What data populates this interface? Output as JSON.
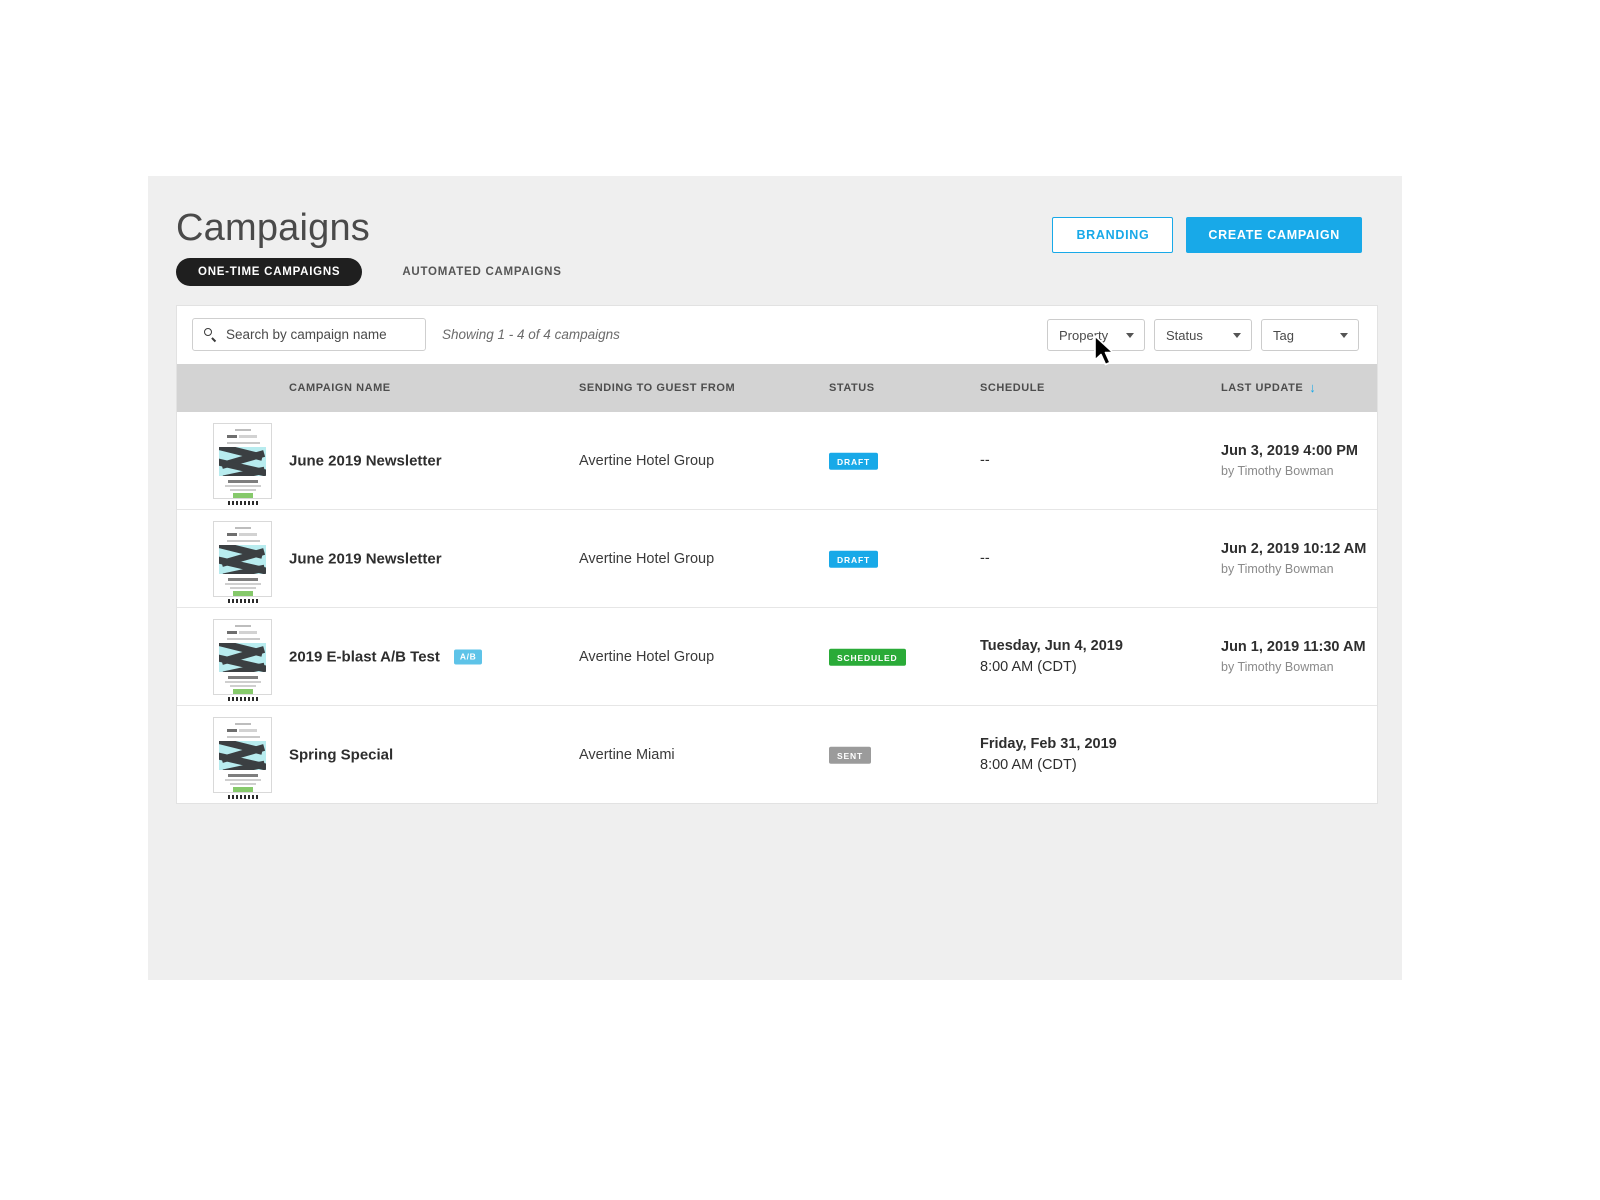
{
  "header": {
    "title": "Campaigns",
    "branding_label": "BRANDING",
    "create_label": "CREATE CAMPAIGN"
  },
  "tabs": [
    {
      "label": "ONE-TIME CAMPAIGNS",
      "active": true
    },
    {
      "label": "AUTOMATED CAMPAIGNS",
      "active": false
    }
  ],
  "toolbar": {
    "search_placeholder": "Search by campaign name",
    "search_value": "",
    "showing_text": "Showing 1 - 4 of 4 campaigns",
    "filters": [
      {
        "label": "Property"
      },
      {
        "label": "Status"
      },
      {
        "label": "Tag"
      }
    ]
  },
  "table": {
    "columns": {
      "name": "CAMPAIGN NAME",
      "sending": "SENDING TO GUEST FROM",
      "status": "STATUS",
      "schedule": "SCHEDULE",
      "last_update": "LAST UPDATE",
      "sort_arrow": "↓"
    },
    "rows": [
      {
        "name": "June 2019 Newsletter",
        "ab": "",
        "sending": "Avertine Hotel Group",
        "status": "DRAFT",
        "status_kind": "draft",
        "schedule_date": "--",
        "schedule_time": "",
        "update_date": "Jun 3, 2019 4:00 PM",
        "update_by": "by Timothy Bowman"
      },
      {
        "name": "June 2019 Newsletter",
        "ab": "",
        "sending": "Avertine Hotel Group",
        "status": "DRAFT",
        "status_kind": "draft",
        "schedule_date": "--",
        "schedule_time": "",
        "update_date": "Jun 2, 2019 10:12 AM",
        "update_by": "by Timothy Bowman"
      },
      {
        "name": "2019 E-blast  A/B Test",
        "ab": "A/B",
        "sending": "Avertine Hotel Group",
        "status": "SCHEDULED",
        "status_kind": "scheduled",
        "schedule_date": "Tuesday, Jun 4, 2019",
        "schedule_time": "8:00 AM (CDT)",
        "update_date": "Jun 1, 2019 11:30 AM",
        "update_by": "by Timothy Bowman"
      },
      {
        "name": "Spring Special",
        "ab": "",
        "sending": "Avertine Miami",
        "status": "SENT",
        "status_kind": "sent",
        "schedule_date": "Friday, Feb 31, 2019",
        "schedule_time": "8:00 AM (CDT)",
        "update_date": "",
        "update_by": ""
      }
    ]
  },
  "colors": {
    "accent": "#18a9e8",
    "scheduled": "#2aab38",
    "sent": "#9b9b9b",
    "ab_badge": "#5ec3e8",
    "canvas": "#efefef",
    "table_head": "#d3d3d3"
  },
  "icons": {
    "search": "search-icon",
    "caret": "chevron-down-icon",
    "sort": "sort-descending-icon",
    "cursor": "mouse-pointer-icon"
  }
}
